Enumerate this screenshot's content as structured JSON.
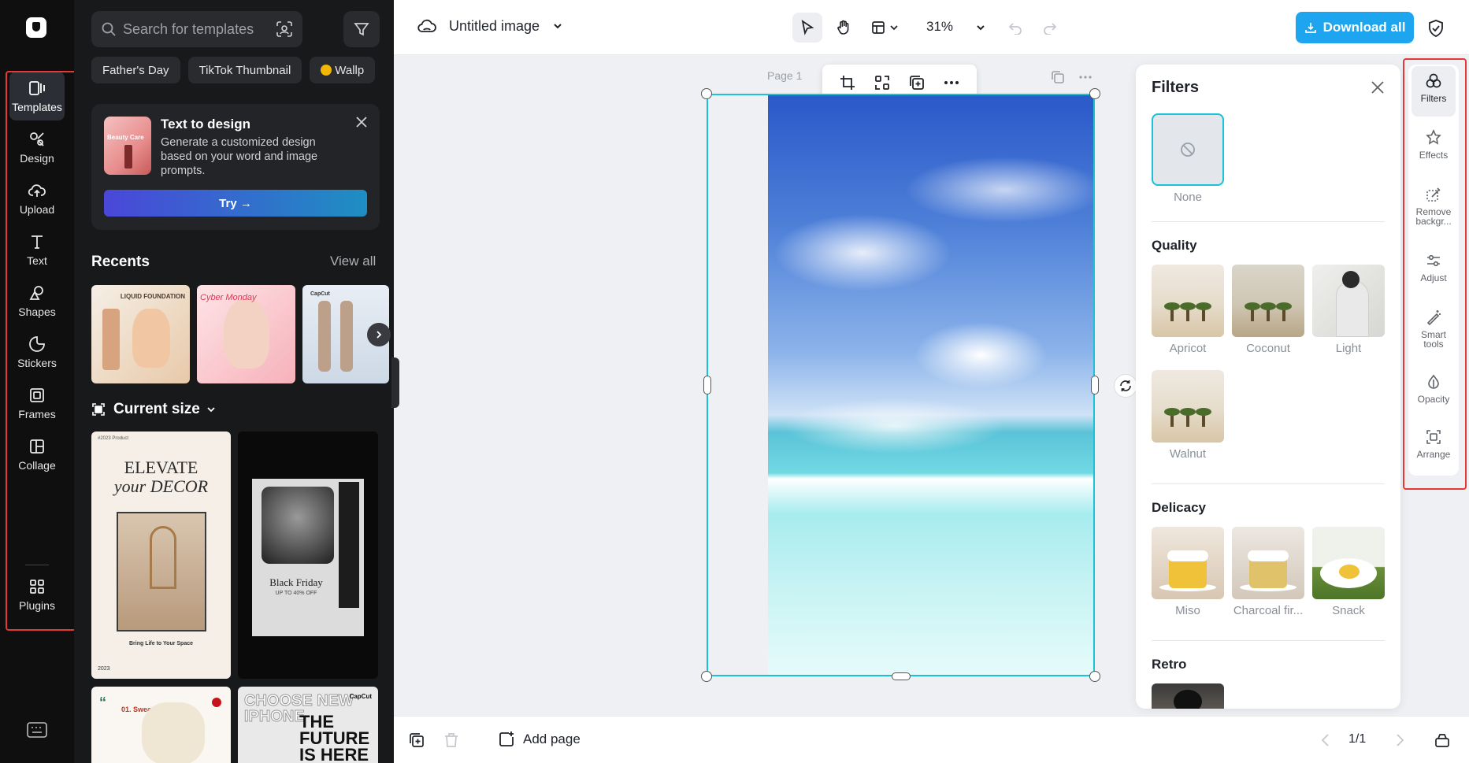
{
  "rail": {
    "items": [
      {
        "label": "Templates",
        "icon": "templates-icon"
      },
      {
        "label": "Design",
        "icon": "design-icon"
      },
      {
        "label": "Upload",
        "icon": "upload-icon"
      },
      {
        "label": "Text",
        "icon": "text-icon"
      },
      {
        "label": "Shapes",
        "icon": "shapes-icon"
      },
      {
        "label": "Stickers",
        "icon": "stickers-icon"
      },
      {
        "label": "Frames",
        "icon": "frames-icon"
      },
      {
        "label": "Collage",
        "icon": "collage-icon"
      },
      {
        "label": "Plugins",
        "icon": "plugins-icon"
      }
    ]
  },
  "panel": {
    "search_placeholder": "Search for templates",
    "chips": [
      "Father's Day",
      "TikTok Thumbnail",
      "Wallp"
    ],
    "text_to_design": {
      "title": "Text to design",
      "description": "Generate a customized design based on your word and image prompts.",
      "thumb_text": "Beauty Care",
      "try_label": "Try →"
    },
    "recents_title": "Recents",
    "view_all": "View all",
    "recent_texts": {
      "r1": "LIQUID FOUNDATION",
      "r2": "Cyber Monday",
      "r3": "CapCut"
    },
    "current_size": "Current size",
    "templates": {
      "t1_header": "#2023 Product",
      "t1_title_1": "ELEVATE",
      "t1_title_2": "your DECOR",
      "t1_footer": "Bring Life to Your Space",
      "t1_year": "2023",
      "t2_title": "Black Friday",
      "t2_sub": "UP TO 40% OFF",
      "t3_label": "01. Sweater",
      "t4_ghost": "CHOOSE NEW IPHONE",
      "t4_main": "THE FUTURE IS HERE",
      "t4_brand": "CapCut"
    }
  },
  "topbar": {
    "doc_title": "Untitled image",
    "zoom": "31%",
    "download_label": "Download all"
  },
  "canvas": {
    "page_label": "Page 1"
  },
  "filters": {
    "title": "Filters",
    "none_label": "None",
    "sections": [
      {
        "title": "Quality",
        "items": [
          "Apricot",
          "Coconut",
          "Light",
          "Walnut"
        ]
      },
      {
        "title": "Delicacy",
        "items": [
          "Miso",
          "Charcoal fir...",
          "Snack"
        ]
      },
      {
        "title": "Retro",
        "items": []
      }
    ]
  },
  "right_strip": {
    "items": [
      {
        "label": "Filters",
        "icon": "filters-icon"
      },
      {
        "label": "Effects",
        "icon": "effects-icon"
      },
      {
        "label": "Remove backgr...",
        "icon": "remove-background-icon"
      },
      {
        "label": "Adjust",
        "icon": "adjust-icon"
      },
      {
        "label": "Smart tools",
        "icon": "smart-tools-icon"
      },
      {
        "label": "Opacity",
        "icon": "opacity-icon"
      },
      {
        "label": "Arrange",
        "icon": "arrange-icon"
      }
    ]
  },
  "bottombar": {
    "add_page": "Add page",
    "page_counter": "1/1"
  },
  "colors": {
    "accent": "#19c2d6",
    "download_button": "#1ea5f0",
    "highlight_box": "#e53935",
    "rail_bg": "#0f0f10",
    "panel_bg": "#18191b"
  }
}
